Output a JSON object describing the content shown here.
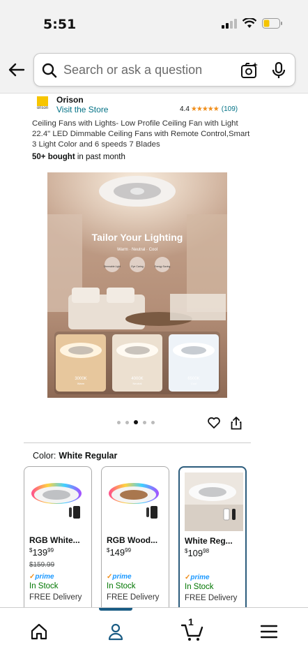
{
  "status": {
    "time": "5:51"
  },
  "search": {
    "placeholder": "Search or ask a question"
  },
  "seller": {
    "brand": "Orison",
    "logo_text": "orison",
    "visit_label": "Visit the Store"
  },
  "rating": {
    "value": "4.4",
    "stars": "★★★★★",
    "count": "(109)"
  },
  "product": {
    "title": "Ceiling Fans with Lights- Low Profile Ceiling Fan with Light 22.4\" LED Dimmable Ceiling Fans with Remote Control,Smart 3 Light Color and 6 speeds 7 Blades",
    "bought_bold": "50+ bought",
    "bought_rest": " in past month"
  },
  "hero": {
    "headline": "Tailor Your Lighting",
    "subline": "Warm · Neutral · Cool",
    "features": [
      "Dimmable Light",
      "Eye Caring",
      "Energy Saving"
    ],
    "temps": [
      {
        "k": "3000K",
        "label": "Warm"
      },
      {
        "k": "4000K",
        "label": "Neutral"
      },
      {
        "k": "6500K",
        "label": "Cool"
      }
    ]
  },
  "carousel": {
    "count": 5,
    "active": 2
  },
  "color": {
    "label": "Color:",
    "value": "White Regular"
  },
  "variants": [
    {
      "name": "RGB White...",
      "price_whole": "139",
      "price_frac": "99",
      "was": "$159.99",
      "prime": "prime",
      "stock": "In Stock",
      "delivery": "FREE Delivery",
      "selected": false
    },
    {
      "name": "RGB Wood...",
      "price_whole": "149",
      "price_frac": "99",
      "was": "",
      "prime": "prime",
      "stock": "In Stock",
      "delivery": "FREE Delivery",
      "selected": false
    },
    {
      "name": "White Reg...",
      "price_whole": "109",
      "price_frac": "98",
      "was": "",
      "prime": "prime",
      "stock": "In Stock",
      "delivery": "FREE Delivery",
      "selected": true
    }
  ],
  "tabs": {
    "cart_count": "1"
  },
  "colors": {
    "accent": "#1a5c84",
    "link": "#007185",
    "stock": "#007600",
    "star": "#f08d19"
  }
}
